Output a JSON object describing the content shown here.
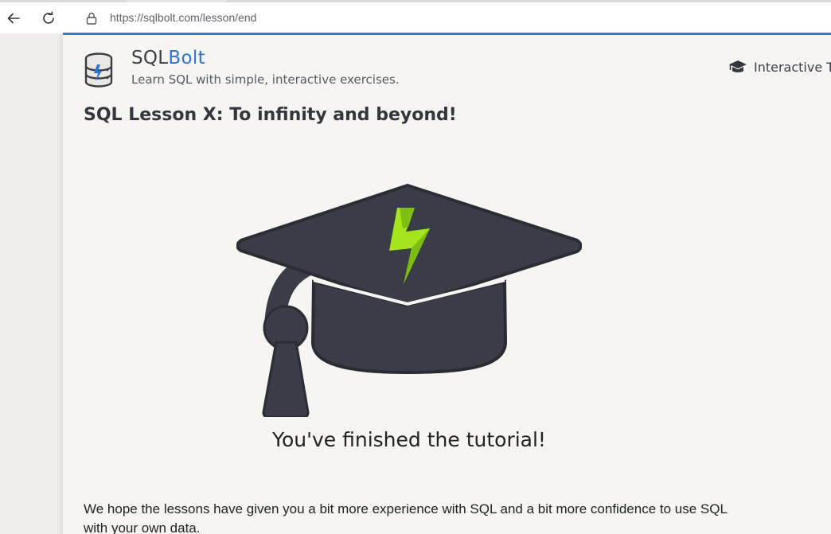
{
  "browser": {
    "url": "https://sqlbolt.com/lesson/end",
    "back_icon": "back-arrow-icon",
    "reload_icon": "reload-icon",
    "lock_icon": "lock-icon",
    "accent_color": "#2f7ad6"
  },
  "site": {
    "brand_sql": "SQL",
    "brand_bolt": "Bolt",
    "brand_color": "#2d74d8",
    "tagline": "Learn SQL with simple, interactive exercises.",
    "nav_link": "Interactive T",
    "logo_icon": "database-bolt-icon"
  },
  "lesson": {
    "title": "SQL Lesson X: To infinity and beyond!",
    "illustration": "graduation-cap-icon",
    "finished_text": "You've finished the tutorial!",
    "body": "We hope the lessons have given you a bit more experience with SQL and a bit more confidence to use SQL with your own data."
  }
}
